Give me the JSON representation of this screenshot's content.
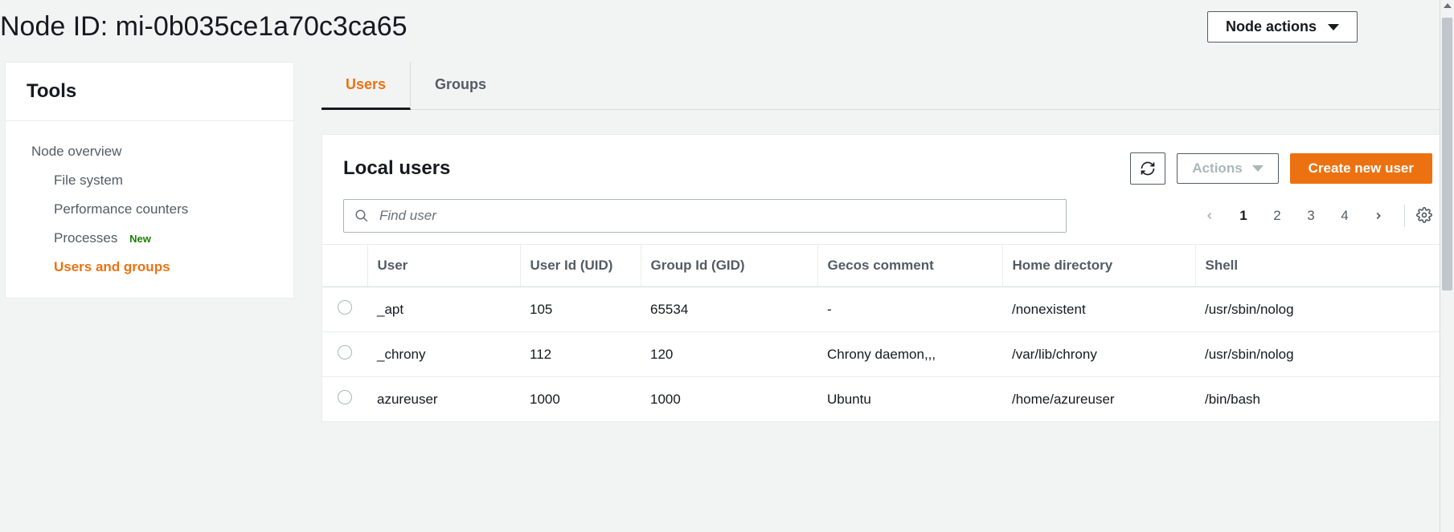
{
  "header": {
    "title": "Node ID: mi-0b035ce1a70c3ca65",
    "node_actions_label": "Node actions"
  },
  "sidebar": {
    "title": "Tools",
    "items": [
      {
        "label": "Node overview",
        "sub": false,
        "active": false,
        "badge": null
      },
      {
        "label": "File system",
        "sub": true,
        "active": false,
        "badge": null
      },
      {
        "label": "Performance counters",
        "sub": true,
        "active": false,
        "badge": null
      },
      {
        "label": "Processes",
        "sub": true,
        "active": false,
        "badge": "New"
      },
      {
        "label": "Users and groups",
        "sub": true,
        "active": true,
        "badge": null
      }
    ]
  },
  "tabs": [
    {
      "label": "Users",
      "active": true
    },
    {
      "label": "Groups",
      "active": false
    }
  ],
  "local_users": {
    "title": "Local users",
    "actions_label": "Actions",
    "create_label": "Create new user",
    "search_placeholder": "Find user",
    "pages": [
      "1",
      "2",
      "3",
      "4"
    ],
    "current_page": "1",
    "columns": [
      "User",
      "User Id (UID)",
      "Group Id (GID)",
      "Gecos comment",
      "Home directory",
      "Shell"
    ],
    "rows": [
      {
        "user": "_apt",
        "uid": "105",
        "gid": "65534",
        "gecos": "-",
        "home": "/nonexistent",
        "shell": "/usr/sbin/nolog"
      },
      {
        "user": "_chrony",
        "uid": "112",
        "gid": "120",
        "gecos": "Chrony daemon,,,",
        "home": "/var/lib/chrony",
        "shell": "/usr/sbin/nolog"
      },
      {
        "user": "azureuser",
        "uid": "1000",
        "gid": "1000",
        "gecos": "Ubuntu",
        "home": "/home/azureuser",
        "shell": "/bin/bash"
      }
    ]
  }
}
